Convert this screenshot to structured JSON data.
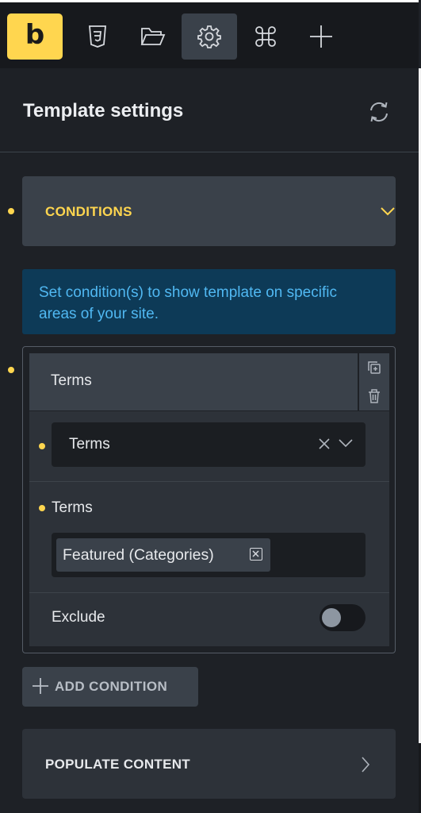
{
  "toolbar": {
    "logo": "b",
    "items": [
      "css3-icon",
      "folder-icon",
      "gear-icon",
      "command-icon",
      "plus-icon"
    ],
    "active": "gear-icon",
    "accent": "#ffd64f"
  },
  "panel": {
    "title": "Template settings"
  },
  "conditions": {
    "section_label": "CONDITIONS",
    "info_text": "Set condition(s) to show template on specific areas of your site.",
    "condition": {
      "header_label": "Terms",
      "type_select_value": "Terms",
      "terms_label": "Terms",
      "selected_tag": "Featured (Categories)",
      "exclude_label": "Exclude",
      "exclude_on": false
    },
    "add_button_label": "ADD CONDITION"
  },
  "populate": {
    "label": "POPULATE CONTENT"
  }
}
